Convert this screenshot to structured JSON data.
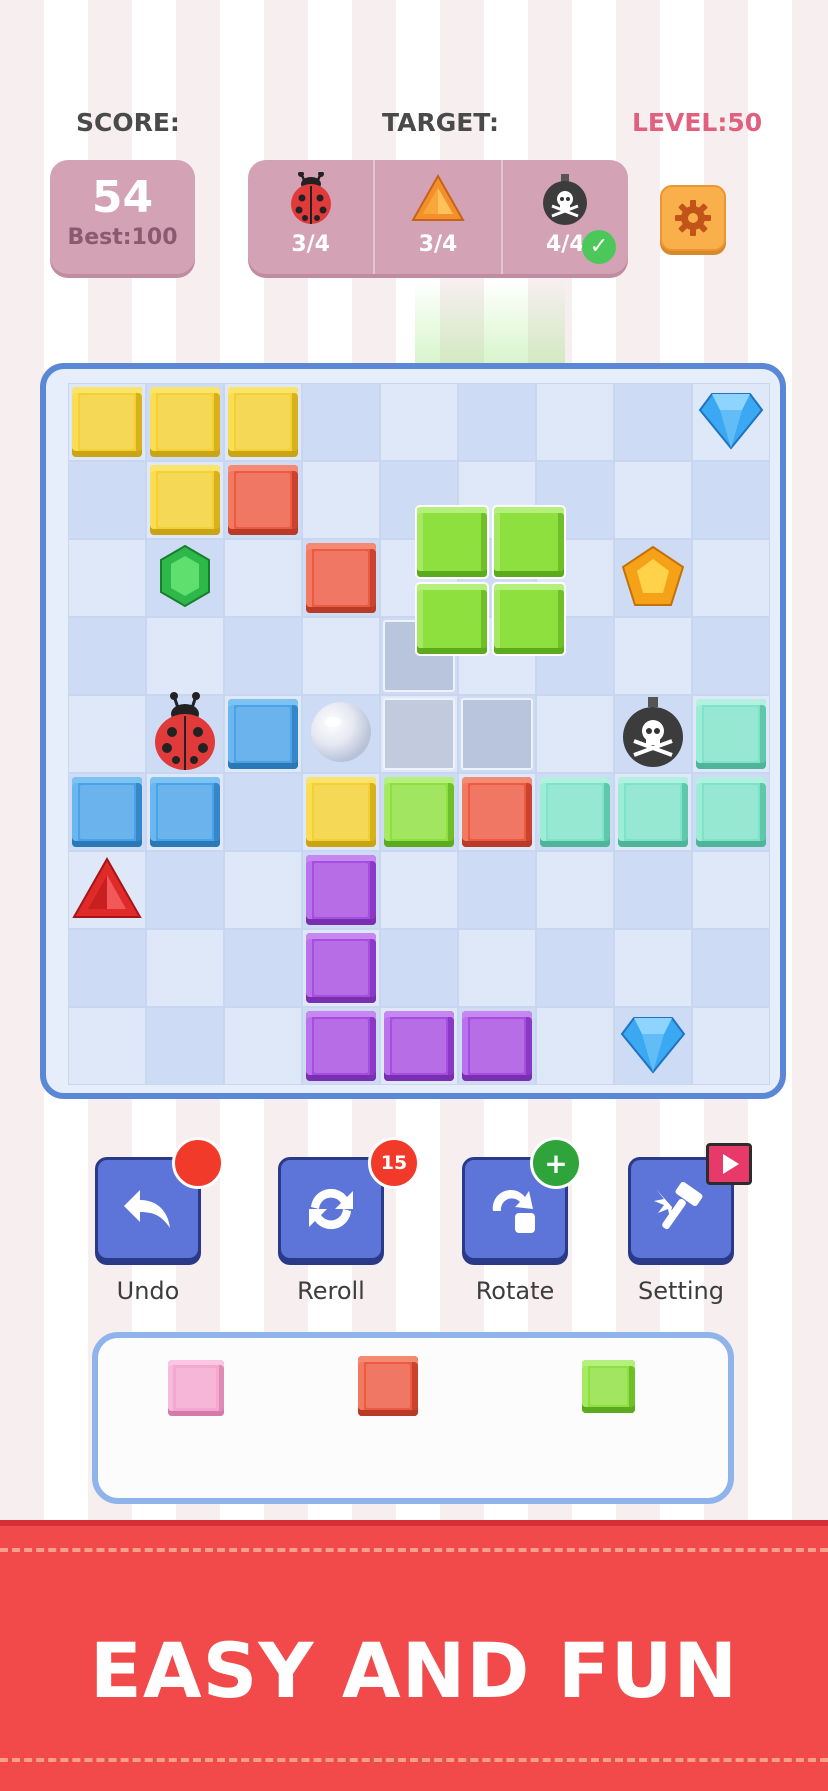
{
  "header": {
    "score_label": "SCORE:",
    "target_label": "TARGET:",
    "level_label": "LEVEL:50"
  },
  "score": {
    "value": "54",
    "best": "Best:100"
  },
  "targets": [
    {
      "icon": "ladybug-icon",
      "count": "3/4",
      "done": false
    },
    {
      "icon": "orange-triangle-gem-icon",
      "count": "3/4",
      "done": false
    },
    {
      "icon": "bomb-skull-icon",
      "count": "4/4",
      "done": true
    }
  ],
  "board": {
    "rows": 9,
    "cols": 9,
    "blocks": [
      {
        "r": 0,
        "c": 0,
        "color": "yellow"
      },
      {
        "r": 0,
        "c": 1,
        "color": "yellow"
      },
      {
        "r": 0,
        "c": 2,
        "color": "yellow"
      },
      {
        "r": 1,
        "c": 1,
        "color": "yellow"
      },
      {
        "r": 1,
        "c": 2,
        "color": "red"
      },
      {
        "r": 2,
        "c": 3,
        "color": "red"
      },
      {
        "r": 4,
        "c": 2,
        "color": "blue"
      },
      {
        "r": 4,
        "c": 8,
        "color": "mint"
      },
      {
        "r": 5,
        "c": 0,
        "color": "blue"
      },
      {
        "r": 5,
        "c": 1,
        "color": "blue"
      },
      {
        "r": 5,
        "c": 3,
        "color": "yellow"
      },
      {
        "r": 5,
        "c": 4,
        "color": "green"
      },
      {
        "r": 5,
        "c": 5,
        "color": "red"
      },
      {
        "r": 5,
        "c": 6,
        "color": "mint"
      },
      {
        "r": 5,
        "c": 7,
        "color": "mint"
      },
      {
        "r": 5,
        "c": 8,
        "color": "mint"
      },
      {
        "r": 6,
        "c": 3,
        "color": "purple"
      },
      {
        "r": 7,
        "c": 3,
        "color": "purple"
      },
      {
        "r": 8,
        "c": 3,
        "color": "purple"
      },
      {
        "r": 8,
        "c": 4,
        "color": "purple"
      },
      {
        "r": 8,
        "c": 5,
        "color": "purple"
      }
    ],
    "ghost_cells": [
      {
        "r": 3,
        "c": 4
      },
      {
        "r": 4,
        "c": 4
      },
      {
        "r": 4,
        "c": 5
      }
    ],
    "items": [
      {
        "r": 0,
        "c": 8,
        "icon": "blue-diamond-icon"
      },
      {
        "r": 2,
        "c": 1,
        "icon": "green-emerald-icon"
      },
      {
        "r": 2,
        "c": 7,
        "icon": "orange-pentagon-gem-icon"
      },
      {
        "r": 4,
        "c": 1,
        "icon": "ladybug-icon"
      },
      {
        "r": 4,
        "c": 3,
        "icon": "pearl-icon"
      },
      {
        "r": 4,
        "c": 7,
        "icon": "bomb-skull-icon"
      },
      {
        "r": 6,
        "c": 0,
        "icon": "red-triangle-gem-icon"
      },
      {
        "r": 8,
        "c": 7,
        "icon": "blue-diamond-icon"
      }
    ]
  },
  "tools": [
    {
      "label": "Undo",
      "icon": "undo-icon",
      "badge": ""
    },
    {
      "label": "Reroll",
      "icon": "reroll-icon",
      "badge": "15"
    },
    {
      "label": "Rotate",
      "icon": "rotate-icon",
      "badge": "+"
    },
    {
      "label": "Setting",
      "icon": "hammer-icon",
      "badge": "video"
    }
  ],
  "colors": {
    "board_border": "#5a87d6",
    "tool_button": "#5d74d8",
    "banner": "#f2494a",
    "level": "#e0607e"
  },
  "banner": {
    "text": "EASY AND FUN"
  }
}
